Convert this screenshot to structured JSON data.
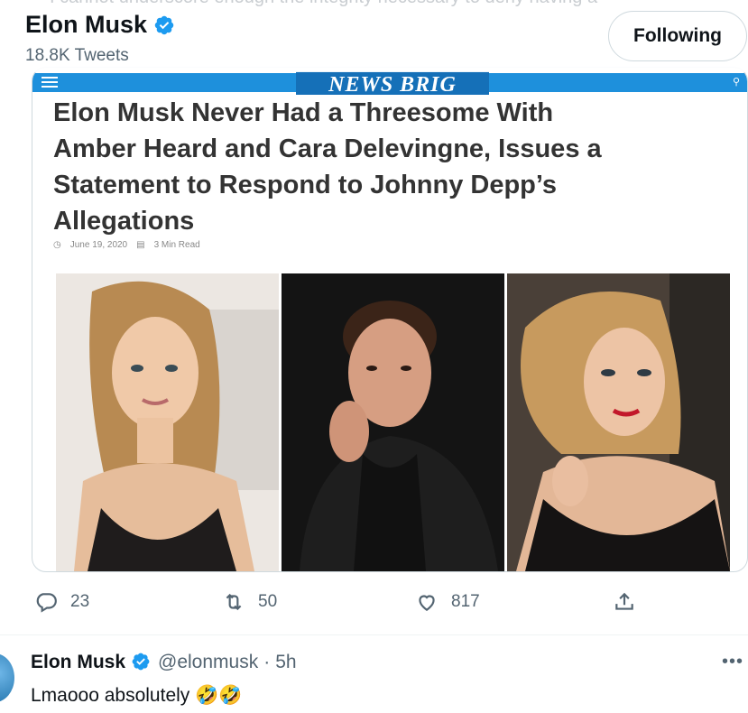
{
  "header": {
    "ghost_text": "I cannot underscore enough the integrity necessary to deny having a",
    "name": "Elon Musk",
    "tweet_count": "18.8K Tweets",
    "follow_label": "Following"
  },
  "card": {
    "site_logo": "NEWS BRIG",
    "headline": "Elon Musk Never Had a Threesome With Amber Heard and Cara Delevingne, Issues a Statement to Respond to Johnny Depp’s Allegations",
    "date": "June 19, 2020",
    "read_time": "3 Min Read"
  },
  "actions": {
    "replies": "23",
    "retweets": "50",
    "likes": "817"
  },
  "reply": {
    "name": "Elon Musk",
    "handle": "@elonmusk",
    "separator": "·",
    "time": "5h",
    "text": "Lmaooo absolutely 🤣🤣",
    "more": "•••"
  },
  "colors": {
    "brand_blue": "#1d9bf0",
    "site_bar": "#1e90dc",
    "muted": "#536471"
  },
  "icons": [
    "verified-badge-icon",
    "hamburger-icon",
    "search-icon",
    "reply-icon",
    "retweet-icon",
    "like-icon",
    "share-icon",
    "more-icon"
  ]
}
